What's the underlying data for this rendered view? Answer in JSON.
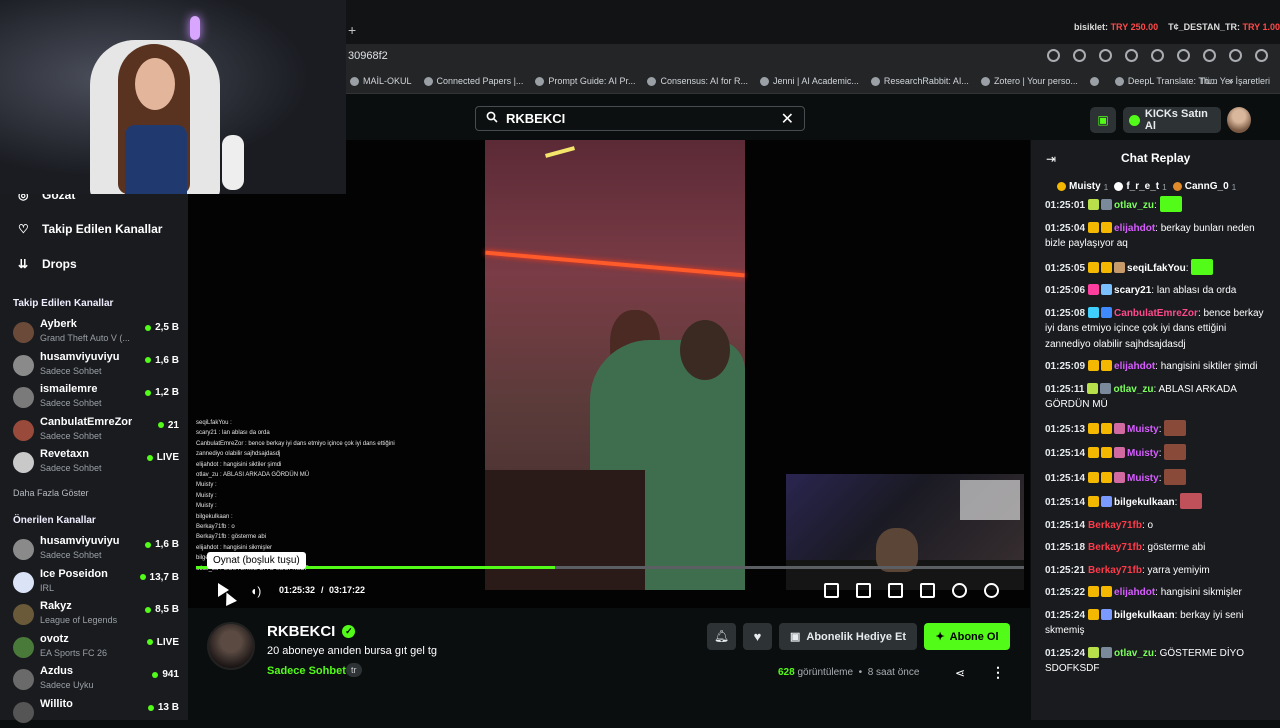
{
  "browser": {
    "new_tab": "+",
    "address": "30968f2",
    "ticker_a": "bisiklet:",
    "ticker_a_val": "TRY 250.00",
    "ticker_b": "T¢_DESTAN_TR:",
    "ticker_b_val": "TRY 1.00",
    "bookmarks": [
      "MAİL-OKUL",
      "Connected Papers |...",
      "Prompt Guide: AI Pr...",
      "Consensus: AI for R...",
      "Jenni | AI Academic...",
      "ResearchRabbit: AI...",
      "Zotero | Your perso...",
      "",
      "DeepL Translate: Th...",
      "»"
    ],
    "bookmarks_right": "Tüm Yer İşaretleri"
  },
  "header": {
    "search_value": "RKBEKCI",
    "kicks_button": "KICKs Satın Al"
  },
  "sidebar": {
    "nav": [
      {
        "label": "Gözat"
      },
      {
        "label": "Takip Edilen Kanallar"
      },
      {
        "label": "Drops"
      }
    ],
    "followed_title": "Takip Edilen Kanallar",
    "followed": [
      {
        "name": "Ayberk",
        "category": "Grand Theft Auto V (...",
        "viewers": "2,5 B",
        "color": "#6b4a3a"
      },
      {
        "name": "husamviyuviyu",
        "category": "Sadece Sohbet",
        "viewers": "1,6 B",
        "color": "#8a8a8a"
      },
      {
        "name": "ismailemre",
        "category": "Sadece Sohbet",
        "viewers": "1,2 B",
        "color": "#7a7a7a"
      },
      {
        "name": "CanbulatEmreZor",
        "category": "Sadece Sohbet",
        "viewers": "21",
        "color": "#9a4a3a"
      },
      {
        "name": "Revetaxn",
        "category": "Sadece Sohbet",
        "viewers": "LIVE",
        "color": "#c9c9c9"
      }
    ],
    "show_more": "Daha Fazla Göster",
    "recommended_title": "Önerilen Kanallar",
    "recommended": [
      {
        "name": "husamviyuviyu",
        "category": "Sadece Sohbet",
        "viewers": "1,6 B",
        "color": "#8a8a8a"
      },
      {
        "name": "Ice Poseidon",
        "category": "IRL",
        "viewers": "13,7 B",
        "color": "#dbe3f6"
      },
      {
        "name": "Rakyz",
        "category": "League of Legends",
        "viewers": "8,5 B",
        "color": "#6a5a3a"
      },
      {
        "name": "ovotz",
        "category": "EA Sports FC 26",
        "viewers": "LIVE",
        "color": "#4a7a3a"
      },
      {
        "name": "Azdus",
        "category": "Sadece Uyku",
        "viewers": "941",
        "color": "#6a6a6a"
      },
      {
        "name": "Willito",
        "category": "",
        "viewers": "13 B",
        "color": "#555555"
      }
    ]
  },
  "player": {
    "tooltip": "Oynat (boşluk tuşu)",
    "progress": 0.4334,
    "time_current": "01:25:32",
    "time_sep": "/",
    "time_total": "03:17:22",
    "overlay_lines": [
      "seqiLfakYou : ",
      "scary21 : lan ablası da orda",
      "CanbulatEmreZor : bence berkay iyi dans etmiyo içince çok iyi dans ettiğini",
      "zannediyo olabilir sajhdsajdasdj",
      "elijahdot : hangisini siktiler şimdi",
      "otlav_zu : ABLASI ARKADA GÖRDÜN MÜ",
      "Muisty : ",
      "Muisty : ",
      "Muisty : ",
      "bilgekulkaan : ",
      "Berkay71fb : o",
      "Berkay71fb : gösterme abi",
      "elijahdot : hangisini sikmişler",
      "bilgekulkaan : ",
      "otlav_zu : GÖSTERME DİYO SDOFKSDF"
    ]
  },
  "channel": {
    "name": "RKBEKCI",
    "title": "20 aboneye anıden bursa gıt gel tg",
    "category": "Sadece Sohbet",
    "language": "tr",
    "gift_sub": "Abonelik Hediye Et",
    "follow": "Abone Ol",
    "view_count": "628",
    "views_label": "görüntüleme",
    "age": "8 saat önce"
  },
  "chat": {
    "title": "Chat Replay",
    "top_gifters": [
      {
        "name": "Muisty",
        "count": "1",
        "color": "#f5b800"
      },
      {
        "name": "f_r_e_t",
        "count": "1",
        "color": "#ffffff"
      },
      {
        "name": "CannG_0",
        "count": "1",
        "color": "#e08a2a"
      }
    ],
    "messages": [
      {
        "time": "01:25:01",
        "user": "otlav_zu",
        "color": "#7cff5b",
        "text": "",
        "badges": [
          "#b8e04a",
          "#7a8a9a"
        ],
        "emote": "#53fc18"
      },
      {
        "time": "01:25:04",
        "user": "elijahdot",
        "color": "#d85cff",
        "text": "berkay bunları neden bizle paylaşıyor aq",
        "badges": [
          "#f5b800",
          "#f5b800"
        ],
        "emote": ""
      },
      {
        "time": "01:25:05",
        "user": "seqiLfakYou",
        "color": "#ffffff",
        "text": "",
        "badges": [
          "#f5b800",
          "#f5b800",
          "#c79a6a"
        ],
        "emote": "#53fc18"
      },
      {
        "time": "01:25:06",
        "user": "scary21",
        "color": "#ffffff",
        "text": "lan ablası da orda",
        "badges": [
          "#ff3fa0",
          "#7ac0ff"
        ],
        "emote": ""
      },
      {
        "time": "01:25:08",
        "user": "CanbulatEmreZor",
        "color": "#ff4a8a",
        "text": "bence berkay iyi dans etmiyo içince çok iyi dans ettiğini zannediyo olabilir sajhdsajdasdj",
        "badges": [
          "#3fd0ff",
          "#3f8aff"
        ],
        "emote": ""
      },
      {
        "time": "01:25:09",
        "user": "elijahdot",
        "color": "#d85cff",
        "text": "hangisini siktiler şimdi",
        "badges": [
          "#f5b800",
          "#f5b800"
        ],
        "emote": ""
      },
      {
        "time": "01:25:11",
        "user": "otlav_zu",
        "color": "#7cff5b",
        "text": "ABLASI ARKADA GÖRDÜN MÜ",
        "badges": [
          "#b8e04a",
          "#7a8a9a"
        ],
        "emote": ""
      },
      {
        "time": "01:25:13",
        "user": "Muisty",
        "color": "#d85cff",
        "text": "",
        "badges": [
          "#f5b800",
          "#f5b800",
          "#d06aa0"
        ],
        "emote": "#8a4a3a"
      },
      {
        "time": "01:25:14",
        "user": "Muisty",
        "color": "#d85cff",
        "text": "",
        "badges": [
          "#f5b800",
          "#f5b800",
          "#d06aa0"
        ],
        "emote": "#8a4a3a"
      },
      {
        "time": "01:25:14",
        "user": "Muisty",
        "color": "#d85cff",
        "text": "",
        "badges": [
          "#f5b800",
          "#f5b800",
          "#d06aa0"
        ],
        "emote": "#8a4a3a"
      },
      {
        "time": "01:25:14",
        "user": "bilgekulkaan",
        "color": "#ffffff",
        "text": "",
        "badges": [
          "#f5b800",
          "#7a9aff"
        ],
        "emote": "#c0505a"
      },
      {
        "time": "01:25:14",
        "user": "Berkay71fb",
        "color": "#ff3b4a",
        "text": "o",
        "badges": [],
        "emote": ""
      },
      {
        "time": "01:25:18",
        "user": "Berkay71fb",
        "color": "#ff3b4a",
        "text": "gösterme abi",
        "badges": [],
        "emote": ""
      },
      {
        "time": "01:25:21",
        "user": "Berkay71fb",
        "color": "#ff3b4a",
        "text": "yarra yemiyim",
        "badges": [],
        "emote": ""
      },
      {
        "time": "01:25:22",
        "user": "elijahdot",
        "color": "#d85cff",
        "text": "hangisini sikmişler",
        "badges": [
          "#f5b800",
          "#f5b800"
        ],
        "emote": ""
      },
      {
        "time": "01:25:24",
        "user": "bilgekulkaan",
        "color": "#ffffff",
        "text": "berkay iyi seni skmemiş",
        "badges": [
          "#f5b800",
          "#7a9aff"
        ],
        "emote": ""
      },
      {
        "time": "01:25:24",
        "user": "otlav_zu",
        "color": "#7cff5b",
        "text": "GÖSTERME DİYO SDOFKSDF",
        "badges": [
          "#b8e04a",
          "#7a8a9a"
        ],
        "emote": ""
      }
    ]
  },
  "colors": {
    "accent": "#53fc18",
    "sidebar_bg": "#191b1f",
    "page_bg": "#0b0e0f"
  },
  "icons": {
    "search": "search-icon",
    "close": "close-icon",
    "bell": "bell-icon",
    "heart": "heart-icon",
    "gift": "gift-icon",
    "share": "share-icon",
    "more": "more-vertical-icon"
  }
}
